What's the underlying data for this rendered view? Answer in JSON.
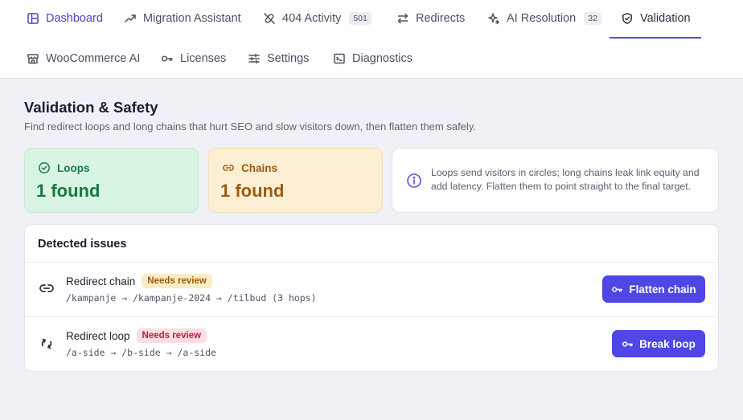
{
  "nav": {
    "items": [
      {
        "label": "Dashboard"
      },
      {
        "label": "Migration Assistant"
      },
      {
        "label": "404 Activity",
        "badge": "501"
      },
      {
        "label": "Redirects"
      },
      {
        "label": "AI Resolution",
        "badge": "32"
      },
      {
        "label": "Validation"
      },
      {
        "label": "WooCommerce AI"
      },
      {
        "label": "Licenses"
      },
      {
        "label": "Settings"
      },
      {
        "label": "Diagnostics"
      }
    ],
    "active_index": 5
  },
  "page": {
    "title": "Validation & Safety",
    "subtitle": "Find redirect loops and long chains that hurt SEO and slow visitors down, then flatten them safely."
  },
  "stats": {
    "loops": {
      "label": "Loops",
      "value": "1 found"
    },
    "chains": {
      "label": "Chains",
      "value": "1 found"
    }
  },
  "info": {
    "text": "Loops send visitors in circles; long chains leak link equity and add latency. Flatten them to point straight to the final target."
  },
  "issues": {
    "title": "Detected issues",
    "rows": [
      {
        "title": "Redirect chain",
        "tag": "Needs review",
        "path": "/kampanje → /kampanje-2024 → /tilbud (3 hops)",
        "action": "Flatten chain"
      },
      {
        "title": "Redirect loop",
        "tag": "Needs review",
        "path": "/a-side → /b-side → /a-side",
        "action": "Break loop"
      }
    ]
  },
  "colors": {
    "accent": "#4f46e5",
    "nav_active": "#4a45c8",
    "loops_bg": "#d8f4e2",
    "loops_text": "#167a3f",
    "chains_bg": "#fdefd4",
    "chains_text": "#9a5c10",
    "tag_warn_bg": "#fbecc7",
    "tag_danger_bg": "#fbdde4",
    "page_bg": "#f0f0f7"
  },
  "icons": {
    "dashboard": "layout-icon",
    "migration": "trending-up-icon",
    "activity": "link-off-icon",
    "redirects": "arrows-left-right-icon",
    "ai": "sparkles-icon",
    "validation": "shield-check-icon",
    "woocommerce": "store-icon",
    "licenses": "key-icon",
    "settings": "sliders-icon",
    "diagnostics": "terminal-icon",
    "loops": "check-circle-icon",
    "chains": "link-icon",
    "info": "info-icon",
    "issue_chain": "link-icon",
    "issue_loop": "refresh-icon",
    "action": "key-icon"
  }
}
